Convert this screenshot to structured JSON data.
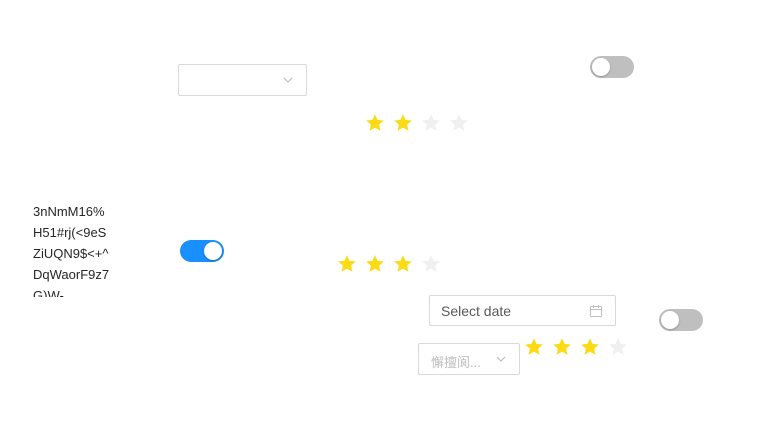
{
  "colors": {
    "primary": "#1890ff",
    "switch_off": "#bfbfbf",
    "star_filled": "#fadb14",
    "star_empty": "#f0f0f0",
    "border": "#d9d9d9",
    "placeholder": "#bfbfbf"
  },
  "select_1": {
    "value": "",
    "icon": "chevron-down-icon"
  },
  "switch_1": {
    "checked": false
  },
  "rate_1": {
    "value": 2,
    "count": 4,
    "icon": "star-icon"
  },
  "text_block": {
    "lines": [
      "3nNmM16%",
      "H51#rj(<9eS",
      "ZiUQN9$<+^",
      "DqWaorF9z7",
      "G)W-"
    ]
  },
  "switch_2": {
    "checked": true
  },
  "rate_2": {
    "value": 3,
    "count": 4,
    "icon": "star-icon"
  },
  "date_picker": {
    "placeholder": "Select date",
    "icon": "calendar-icon"
  },
  "switch_3": {
    "checked": false
  },
  "select_2": {
    "placeholder": "懈擅阆...",
    "icon": "chevron-down-icon"
  },
  "rate_3": {
    "value": 3,
    "count": 4,
    "icon": "star-icon"
  }
}
